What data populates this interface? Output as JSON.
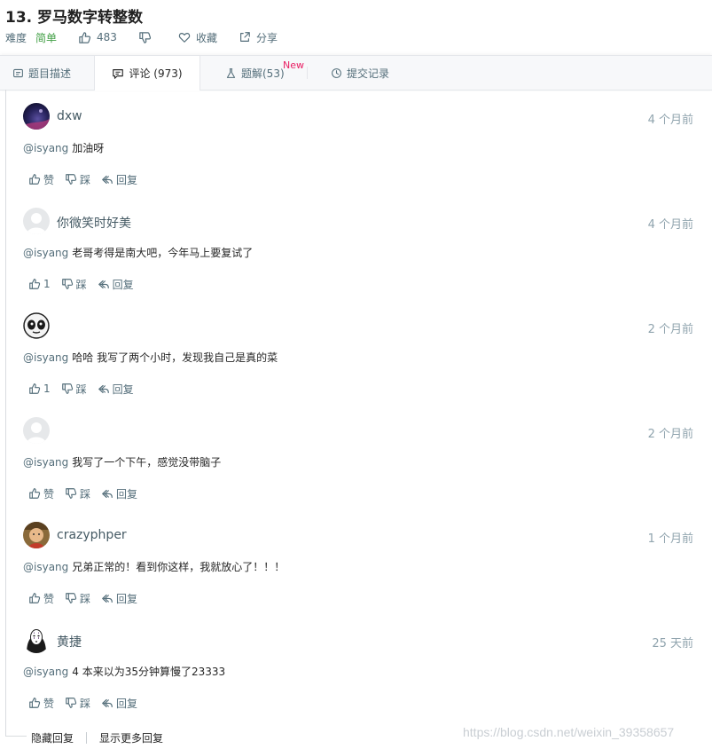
{
  "problem": {
    "title": "13. 罗马数字转整数",
    "difficulty_label": "难度",
    "difficulty": "简单",
    "likes": "483",
    "favorite_label": "收藏",
    "share_label": "分享"
  },
  "tabs": [
    {
      "label": "题目描述"
    },
    {
      "label": "评论 (973)"
    },
    {
      "label": "题解(53)",
      "badge": "New"
    },
    {
      "label": "提交记录"
    }
  ],
  "comments": [
    {
      "user": "dxw",
      "time": "4 个月前",
      "mention": "@isyang",
      "text": "加油呀",
      "likes": "赞"
    },
    {
      "user": "你微笑时好美",
      "time": "4 个月前",
      "mention": "@isyang",
      "text": "老哥考得是南大吧，今年马上要复试了",
      "likes": "1"
    },
    {
      "user": "",
      "time": "2 个月前",
      "mention": "@isyang",
      "text": "哈哈 我写了两个小时，发现我自己是真的菜",
      "likes": "1"
    },
    {
      "user": "",
      "time": "2 个月前",
      "mention": "@isyang",
      "text": "我写了一个下午，感觉没带脑子",
      "likes": "赞"
    },
    {
      "user": "crazyphper",
      "time": "1 个月前",
      "mention": "@isyang",
      "text": "兄弟正常的！看到你这样，我就放心了！！！",
      "likes": "赞"
    },
    {
      "user": "黄捷",
      "time": "25 天前",
      "mention": "@isyang",
      "text": "4 本来以为35分钟算慢了23333",
      "likes": "赞"
    }
  ],
  "actions": {
    "dislike": "踩",
    "reply": "回复"
  },
  "footer": {
    "hide_replies": "隐藏回复",
    "show_more": "显示更多回复"
  },
  "watermark": "https://blog.csdn.net/weixin_39358657",
  "colors": {
    "easy": "#43a047",
    "new_badge": "#e91e63",
    "link": "#546e7a"
  }
}
